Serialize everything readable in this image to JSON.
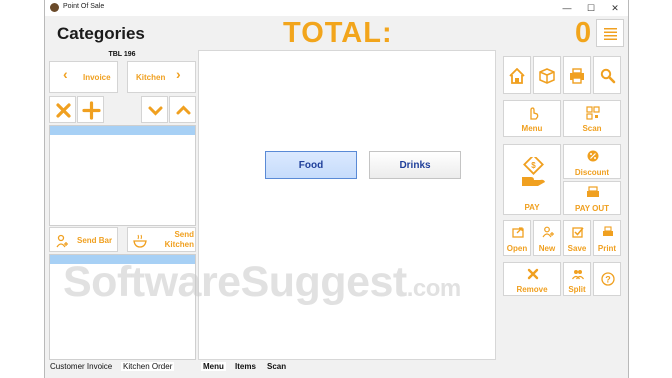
{
  "window": {
    "title": "Point Of Sale",
    "controls": [
      "—",
      "☐",
      "✕"
    ]
  },
  "header": {
    "categories_title": "Categories",
    "total_label": "TOTAL:",
    "total_value": "0",
    "menu_icon": "hamburger-icon"
  },
  "left_panel": {
    "table_label": "TBL 196",
    "invoice_label": "Invoice",
    "kitchen_label": "Kitchen",
    "send_bar_label": "Send Bar",
    "send_kitchen_label": "Send Kitchen",
    "tabs": [
      "Customer Invoice",
      "Kitchen Order"
    ]
  },
  "center": {
    "categories": [
      "Food",
      "Drinks"
    ],
    "tabs": [
      "Menu",
      "Items",
      "Scan"
    ]
  },
  "right_panel": {
    "menu_label": "Menu",
    "scan_label": "Scan",
    "discount_label": "Discount",
    "pay_label": "PAY",
    "pay_out_label": "PAY OUT",
    "open_label": "Open",
    "new_label": "New",
    "save_label": "Save",
    "print_label": "Print",
    "remove_label": "Remove",
    "split_label": "Split"
  },
  "watermark": {
    "text": "SoftwareSuggest",
    "suffix": ".com"
  },
  "colors": {
    "accent": "#f0a020",
    "selected_row": "#a7d0f5",
    "food_button": "#c6dcfb",
    "food_text": "#1f3f9a"
  }
}
